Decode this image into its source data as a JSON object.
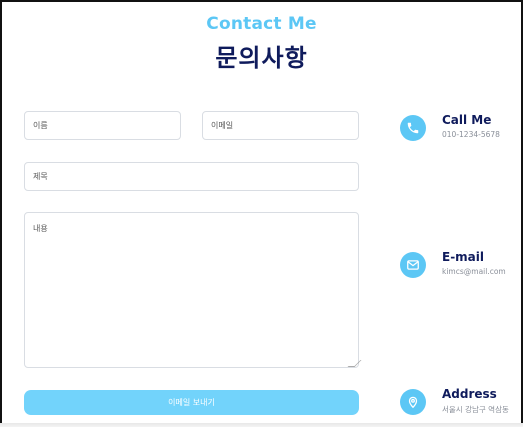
{
  "header": {
    "subtitle": "Contact Me",
    "title": "문의사항"
  },
  "form": {
    "name_placeholder": "이름",
    "email_placeholder": "이메일",
    "subject_placeholder": "제목",
    "message_placeholder": "내용",
    "send_label": "이메일 보내기"
  },
  "contact": {
    "phone": {
      "title": "Call Me",
      "detail": "010-1234-5678",
      "icon": "phone-icon"
    },
    "email": {
      "title": "E-mail",
      "detail": "kimcs@mail.com",
      "icon": "mail-icon"
    },
    "address": {
      "title": "Address",
      "detail": "서울시 강남구 역삼동",
      "icon": "location-pin-icon"
    }
  },
  "colors": {
    "accent": "#5cc7f5",
    "button": "#72d3fb",
    "title": "#0f1b5c"
  }
}
